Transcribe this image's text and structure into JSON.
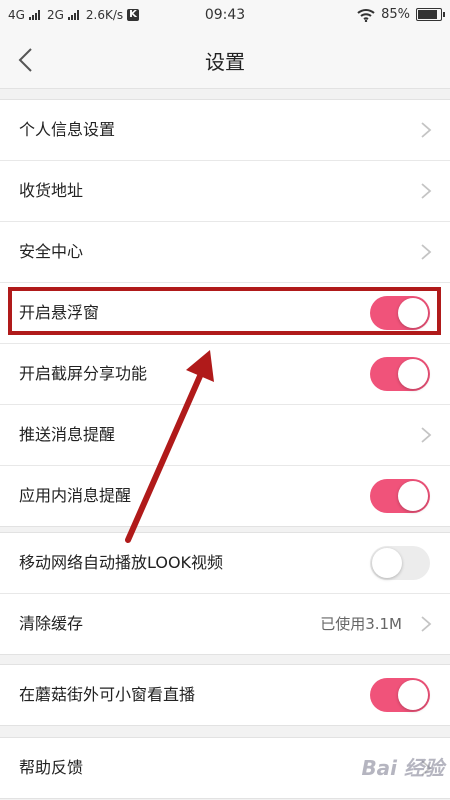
{
  "status_bar": {
    "net1": "4G",
    "net2": "2G",
    "speed": "2.6K/s",
    "k_badge": "K",
    "time": "09:43",
    "battery": "85%",
    "battery_level": 0.85
  },
  "header": {
    "title": "设置"
  },
  "groups": [
    {
      "items": [
        {
          "label": "个人信息设置",
          "control": "chevron"
        },
        {
          "label": "收货地址",
          "control": "chevron"
        },
        {
          "label": "安全中心",
          "control": "chevron"
        },
        {
          "label": "开启悬浮窗",
          "control": "toggle",
          "on": true
        },
        {
          "label": "开启截屏分享功能",
          "control": "toggle",
          "on": true
        },
        {
          "label": "推送消息提醒",
          "control": "chevron"
        },
        {
          "label": "应用内消息提醒",
          "control": "toggle",
          "on": true
        }
      ]
    },
    {
      "items": [
        {
          "label": "移动网络自动播放LOOK视频",
          "control": "toggle",
          "on": false
        },
        {
          "label": "清除缓存",
          "control": "chevron",
          "value": "已使用3.1M"
        }
      ]
    },
    {
      "items": [
        {
          "label": "在蘑菇街外可小窗看直播",
          "control": "toggle",
          "on": true
        }
      ]
    },
    {
      "items": [
        {
          "label": "帮助反馈",
          "control": "chevron"
        }
      ]
    }
  ],
  "watermark": "Bai 经验",
  "colors": {
    "toggle_on": "#f0537a",
    "annotation": "#b01a1a"
  }
}
